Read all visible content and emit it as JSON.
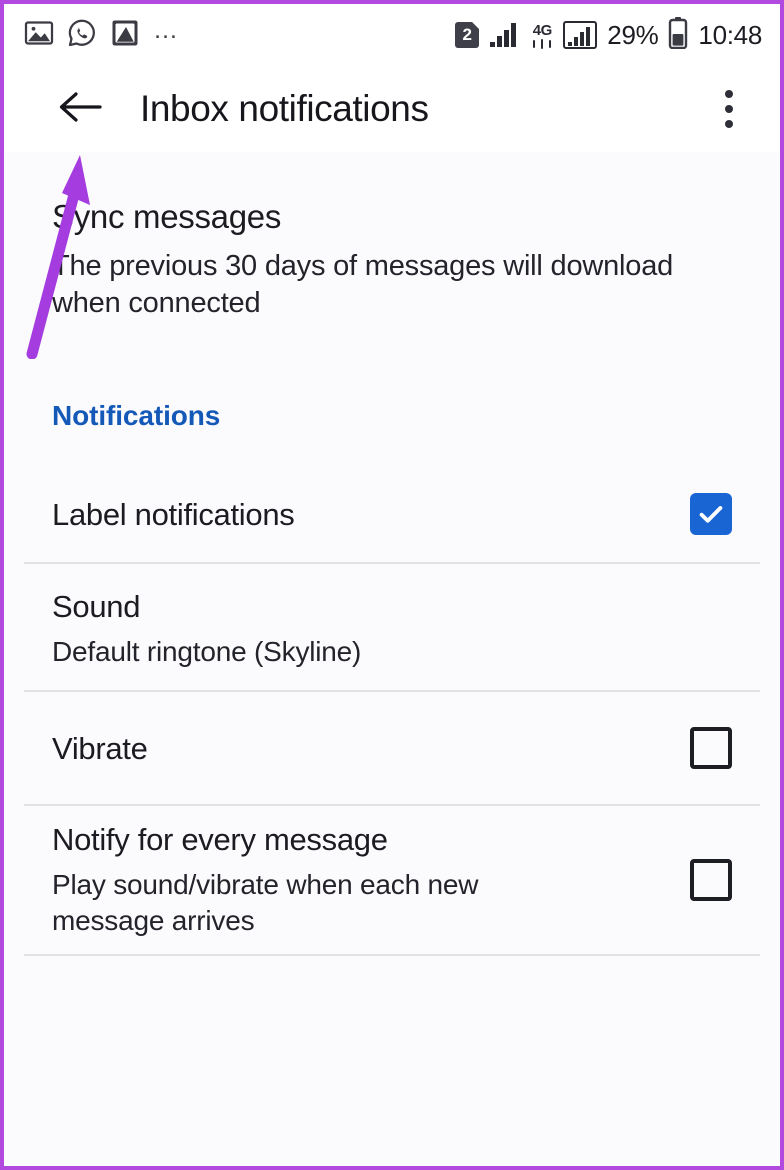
{
  "theme": {
    "accent_blue": "#1a65d4",
    "section_header_blue": "#1458b8",
    "annotation_purple": "#a43ce0",
    "border_purple": "#b24ae0",
    "divider_gray": "#e2e2e6",
    "text_primary": "#1b1b21"
  },
  "status_bar": {
    "left_icons": [
      {
        "name": "image-icon",
        "glyph": "picture"
      },
      {
        "name": "whatsapp-icon",
        "glyph": "whatsapp"
      },
      {
        "name": "screenshot-icon",
        "glyph": "screenshot"
      }
    ],
    "overflow_ellipsis": "…",
    "sim_badge": "2",
    "network_type": "4G",
    "battery_percent": "29%",
    "clock": "10:48"
  },
  "app_bar": {
    "back_label": "Back",
    "title": "Inbox notifications",
    "overflow_label": "More options"
  },
  "sync": {
    "title": "Sync messages",
    "subtitle": "The previous 30 days of messages will download when connected"
  },
  "section": {
    "notifications_header": "Notifications"
  },
  "rows": [
    {
      "name": "label-notifications",
      "title": "Label notifications",
      "subtitle": "",
      "control": "checkbox",
      "checked": true
    },
    {
      "name": "sound",
      "title": "Sound",
      "subtitle": "Default ringtone (Skyline)",
      "control": "none",
      "checked": false
    },
    {
      "name": "vibrate",
      "title": "Vibrate",
      "subtitle": "",
      "control": "checkbox",
      "checked": false
    },
    {
      "name": "notify-every-message",
      "title": "Notify for every message",
      "subtitle": "Play sound/vibrate when each new message arrives",
      "control": "checkbox",
      "checked": false
    }
  ],
  "annotation": {
    "arrow_name": "annotation-arrow",
    "points_to": "back-button"
  }
}
